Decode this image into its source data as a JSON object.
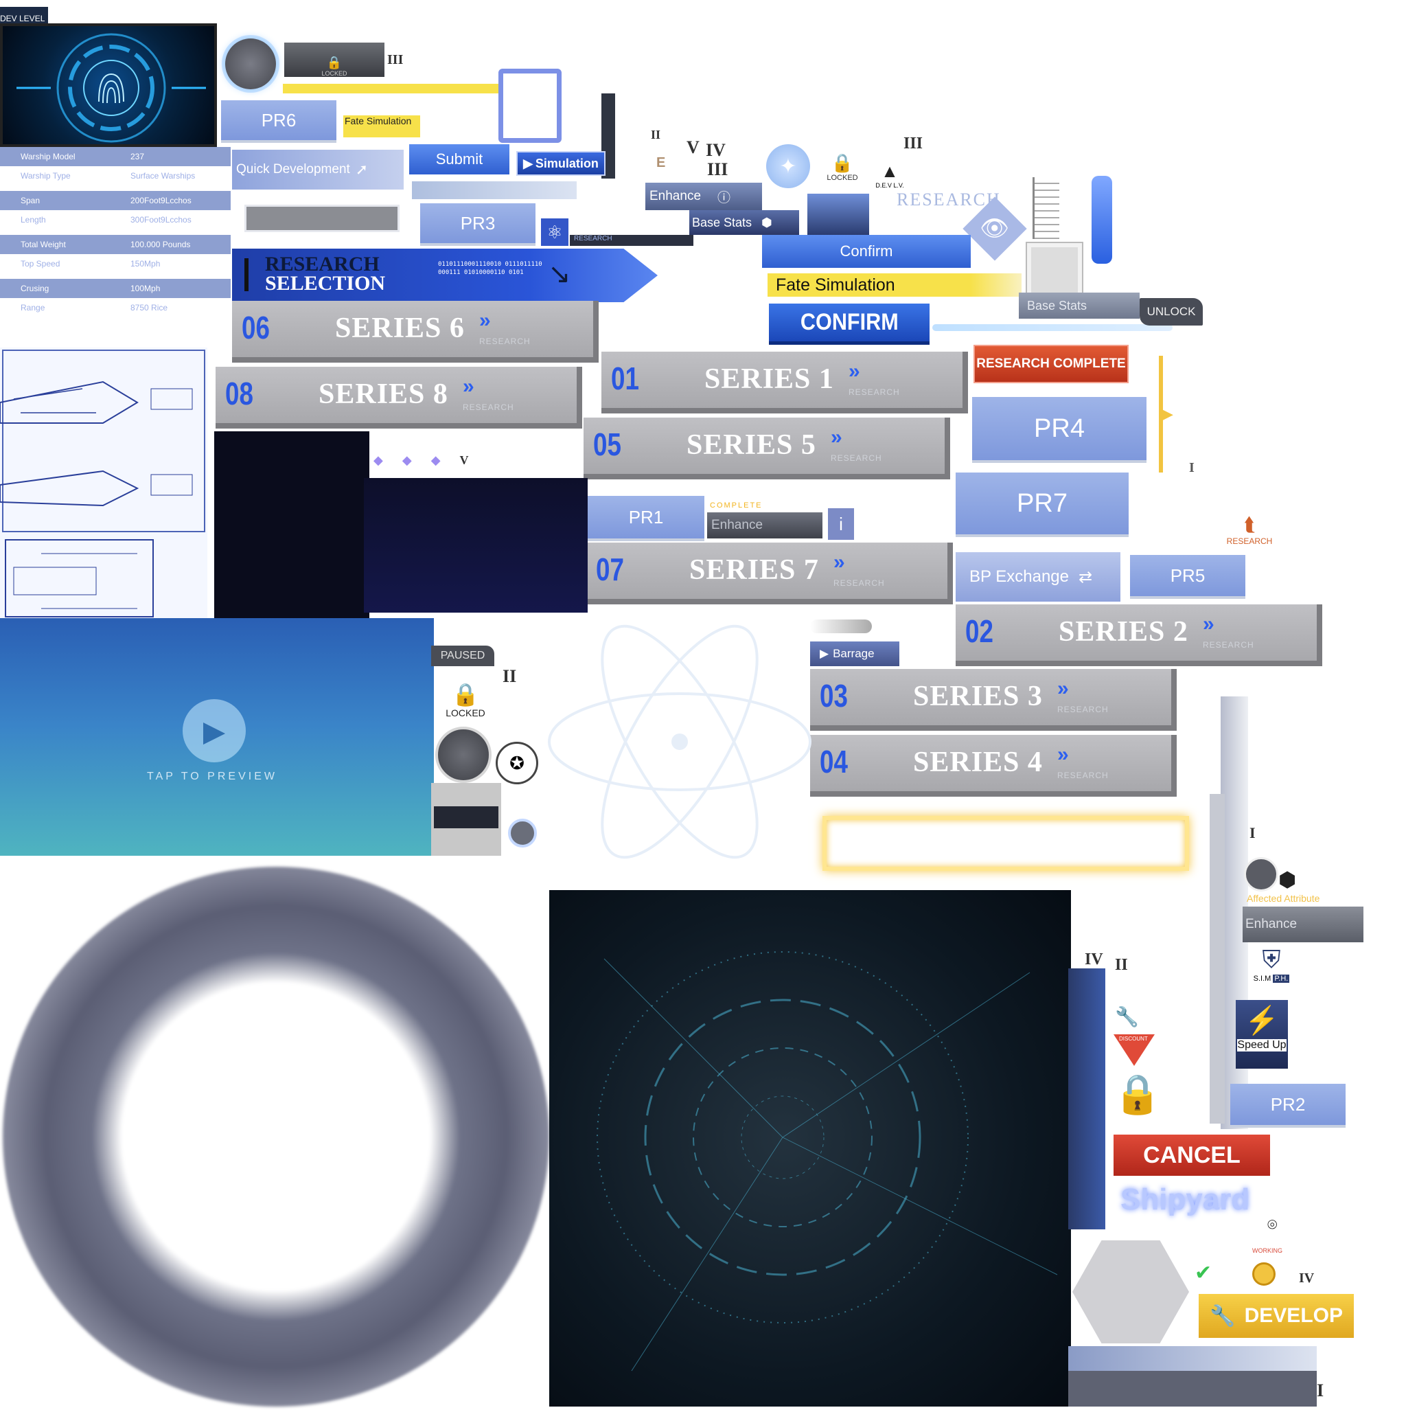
{
  "dev_level": "DEV LEVEL",
  "locked": "LOCKED",
  "pr_labels": {
    "pr1": "PR1",
    "pr2": "PR2",
    "pr3": "PR3",
    "pr4": "PR4",
    "pr5": "PR5",
    "pr6": "PR6",
    "pr7": "PR7"
  },
  "buttons": {
    "fate_simulation_small": "Fate Simulation",
    "fate_simulation": "Fate Simulation",
    "quick_development": "Quick Development",
    "submit": "Submit",
    "simulation": "Simulation",
    "enhance": "Enhance",
    "base_stats": "Base Stats",
    "confirm": "Confirm",
    "confirm_big": "CONFIRM",
    "unlock": "UNLOCK",
    "research_complete": "RESEARCH COMPLETE",
    "bp_exchange": "BP Exchange",
    "barrage": "Barrage",
    "paused": "PAUSED",
    "cancel": "CANCEL",
    "develop": "DEVELOP",
    "speed_up": "Speed Up",
    "tap_to_preview": "Tap to preview",
    "shipyard": "Shipyard",
    "working": "WORKING",
    "discount": "DISCOUNT",
    "affected_attribute": "Affected Attribute",
    "complete": "COMPLETE",
    "research_badge": "RESEARCH",
    "sim_ph": "S.I.M",
    "ph": "P.H.",
    "dev_lv": "D.E.V L.V."
  },
  "research_header": {
    "line1": "RESEARCH",
    "line2": "SELECTION",
    "binary1": "01101110001110010 0111011110",
    "binary2": "000111 01010000110 0101",
    "research_word": "RESEARCH",
    "research_small": "RESEARCH"
  },
  "specs": [
    {
      "label": "Warship Model",
      "value": "237"
    },
    {
      "label": "Warship Type",
      "value": "Surface Warships"
    },
    {
      "label": "Span",
      "value": "200Foot9Lcchos"
    },
    {
      "label": "Length",
      "value": "300Foot9Lcchos"
    },
    {
      "label": "Total Weight",
      "value": "100.000 Pounds"
    },
    {
      "label": "Top Speed",
      "value": "150Mph"
    },
    {
      "label": "Crusing",
      "value": "100Mph"
    },
    {
      "label": "Range",
      "value": "8750 Rice"
    }
  ],
  "series": [
    {
      "num": "06",
      "title": "SERIES 6",
      "sub": "RESEARCH"
    },
    {
      "num": "08",
      "title": "SERIES 8",
      "sub": "RESEARCH"
    },
    {
      "num": "01",
      "title": "SERIES 1",
      "sub": "RESEARCH"
    },
    {
      "num": "05",
      "title": "SERIES 5",
      "sub": "RESEARCH"
    },
    {
      "num": "07",
      "title": "SERIES 7",
      "sub": "RESEARCH"
    },
    {
      "num": "02",
      "title": "SERIES 2",
      "sub": "RESEARCH"
    },
    {
      "num": "03",
      "title": "SERIES 3",
      "sub": "RESEARCH"
    },
    {
      "num": "04",
      "title": "SERIES 4",
      "sub": "RESEARCH"
    }
  ],
  "chevrons": "»",
  "roman": {
    "i": "I",
    "ii": "II",
    "iii": "III",
    "iv": "IV",
    "v": "V"
  },
  "colors": {
    "accent_blue": "#2f5fd0",
    "series_num": "#2a57e0",
    "series_gray": "#b4b4b8",
    "cancel_red": "#c8392b",
    "develop_gold": "#f0c030",
    "yellow_bar": "#f7e14a"
  }
}
